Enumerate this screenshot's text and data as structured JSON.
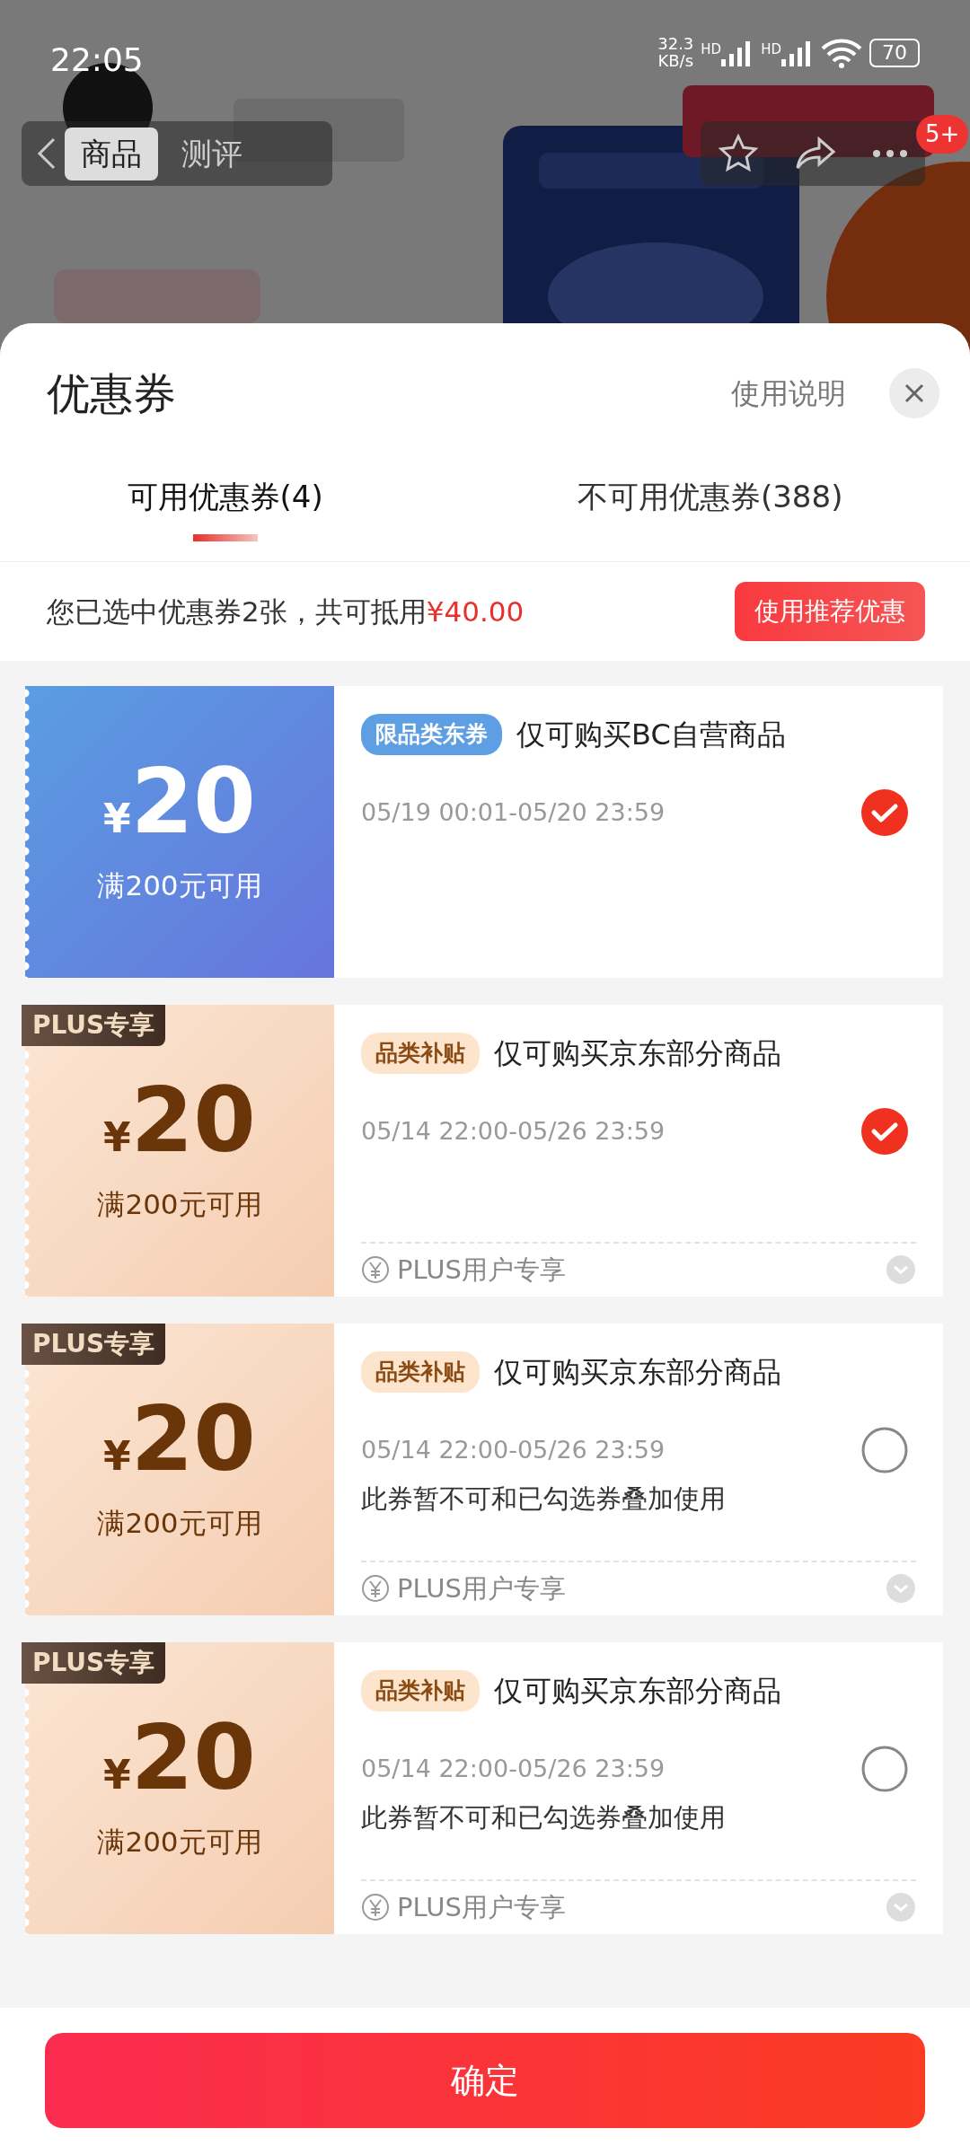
{
  "status_bar": {
    "time": "22:05",
    "speed": "32.3",
    "speed_unit": "KB/s",
    "network_labels": [
      "HD",
      "HD"
    ],
    "battery": "70"
  },
  "background_page": {
    "tabs": [
      {
        "label": "商品",
        "selected": true
      },
      {
        "label": "测评",
        "selected": false
      }
    ],
    "badge": "5+"
  },
  "sheet": {
    "title": "优惠券",
    "help_link": "使用说明",
    "tabs": [
      {
        "label": "可用优惠券(4)",
        "selected": true
      },
      {
        "label": "不可用优惠券(388)",
        "selected": false
      }
    ],
    "summary": {
      "text": "您已选中优惠券2张，共可抵用",
      "amount": "¥40.00",
      "button": "使用推荐优惠"
    },
    "coupons": [
      {
        "kind": "standard",
        "currency": "¥",
        "amount": "20",
        "condition": "满200元可用",
        "tag": "限品类东券",
        "title": "仅可购买BC自营商品",
        "validity": "05/19 00:01-05/20 23:59",
        "selected": true
      },
      {
        "kind": "plus",
        "badge": "PLUS专享",
        "currency": "¥",
        "amount": "20",
        "condition": "满200元可用",
        "tag": "品类补贴",
        "title": "仅可购买京东部分商品",
        "validity": "05/14 22:00-05/26 23:59",
        "selected": true,
        "footer": "PLUS用户专享"
      },
      {
        "kind": "plus",
        "badge": "PLUS专享",
        "currency": "¥",
        "amount": "20",
        "condition": "满200元可用",
        "tag": "品类补贴",
        "title": "仅可购买京东部分商品",
        "validity": "05/14 22:00-05/26 23:59",
        "selected": false,
        "note": "此券暂不可和已勾选券叠加使用",
        "footer": "PLUS用户专享"
      },
      {
        "kind": "plus",
        "badge": "PLUS专享",
        "currency": "¥",
        "amount": "20",
        "condition": "满200元可用",
        "tag": "品类补贴",
        "title": "仅可购买京东部分商品",
        "validity": "05/14 22:00-05/26 23:59",
        "selected": false,
        "note": "此券暂不可和已勾选券叠加使用",
        "footer": "PLUS用户专享"
      }
    ],
    "confirm_button": "确定"
  }
}
